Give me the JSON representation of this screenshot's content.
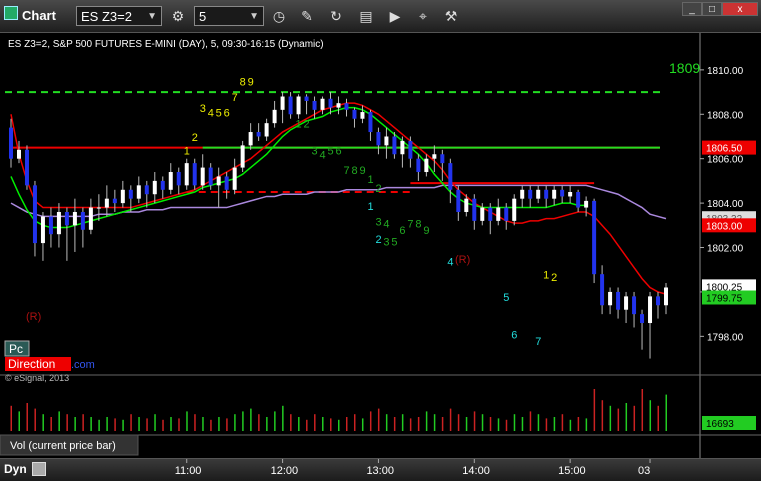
{
  "window": {
    "title": "Chart",
    "symbol_value": "ES Z3=2",
    "interval_value": "5",
    "min_label": "_",
    "max_label": "□",
    "close_label": "x"
  },
  "toolbar": {
    "tool_icons": [
      "link-icon",
      "clock-icon",
      "pencil-icon",
      "refresh-icon",
      "studies-icon",
      "play-icon",
      "tools-icon"
    ]
  },
  "chart": {
    "header": "ES Z3=2, S&P 500 FUTURES E-MINI (DAY), 5, 09:30-16:15 (Dynamic)",
    "watermark_pc": "Pc",
    "watermark_direction": "Direction",
    "watermark_com": ".com",
    "copyright": "© eSignal, 2013",
    "volume_label": "Vol (current price bar)",
    "status_label": "Dyn",
    "hline_label": "1809",
    "r_markers": [
      "(R)",
      "(R)"
    ],
    "price_tags": {
      "up": "1806.50",
      "mid": "1803.32",
      "red": "1803.00",
      "last": "1800.25",
      "green": "1799.75"
    },
    "volume_tag": "16693",
    "colors": {
      "bull": "#ffffff",
      "bear": "#2233ee",
      "wick": "#bbbbbb",
      "ema_fast": "#00ee00",
      "ema_slow": "#ee0000",
      "vwap": "#aa88dd",
      "level_red": "#ee0000",
      "level_green": "#22dd22",
      "tag_red": "#ee0000",
      "tag_green": "#22cc22",
      "count_yellow": "#eeee00",
      "count_green": "#22aa22",
      "count_cyan": "#22dddd",
      "r_color": "#aa1111"
    }
  },
  "chart_data": {
    "type": "candlestick",
    "title": "ES Z3=2, S&P 500 FUTURES E-MINI (DAY), 5, 09:30-16:15 (Dynamic)",
    "x_ticks": [
      "11:00",
      "12:00",
      "13:00",
      "14:00",
      "15:00",
      "03"
    ],
    "y_ticks": [
      "1810.00",
      "1808.00",
      "1806.00",
      "1804.00",
      "1802.00",
      "1800.00",
      "1798.00"
    ],
    "ylim": [
      1796.8,
      1811.3
    ],
    "candles": [
      [
        1807.4,
        1806.0,
        1807.8,
        1805.6
      ],
      [
        1806.0,
        1806.4,
        1806.8,
        1805.8
      ],
      [
        1806.4,
        1804.8,
        1806.6,
        1804.6
      ],
      [
        1804.8,
        1802.2,
        1805.0,
        1801.6
      ],
      [
        1802.2,
        1803.4,
        1803.6,
        1801.4
      ],
      [
        1803.4,
        1802.6,
        1803.8,
        1802.0
      ],
      [
        1802.6,
        1803.6,
        1804.0,
        1802.0
      ],
      [
        1803.6,
        1803.0,
        1803.8,
        1801.4
      ],
      [
        1803.0,
        1803.6,
        1804.2,
        1801.8
      ],
      [
        1803.6,
        1802.8,
        1803.8,
        1802.0
      ],
      [
        1802.8,
        1803.8,
        1804.2,
        1802.6
      ],
      [
        1803.8,
        1803.8,
        1804.4,
        1803.2
      ],
      [
        1803.8,
        1804.2,
        1804.8,
        1803.4
      ],
      [
        1804.2,
        1804.0,
        1804.6,
        1803.6
      ],
      [
        1804.0,
        1804.6,
        1805.0,
        1803.8
      ],
      [
        1804.6,
        1804.2,
        1804.8,
        1803.6
      ],
      [
        1804.2,
        1804.8,
        1805.2,
        1804.0
      ],
      [
        1804.8,
        1804.4,
        1805.0,
        1803.8
      ],
      [
        1804.4,
        1805.0,
        1805.4,
        1804.0
      ],
      [
        1805.0,
        1804.6,
        1805.2,
        1804.2
      ],
      [
        1804.6,
        1805.4,
        1805.8,
        1804.4
      ],
      [
        1805.4,
        1804.8,
        1805.6,
        1804.4
      ],
      [
        1804.8,
        1805.8,
        1806.0,
        1804.6
      ],
      [
        1805.8,
        1804.8,
        1806.0,
        1804.6
      ],
      [
        1804.8,
        1805.6,
        1806.2,
        1804.6
      ],
      [
        1805.6,
        1804.8,
        1805.8,
        1804.6
      ],
      [
        1804.8,
        1805.2,
        1805.6,
        1803.8
      ],
      [
        1805.2,
        1804.6,
        1805.4,
        1804.2
      ],
      [
        1804.6,
        1805.6,
        1806.0,
        1804.4
      ],
      [
        1805.6,
        1806.6,
        1806.8,
        1805.4
      ],
      [
        1806.6,
        1807.2,
        1807.6,
        1806.4
      ],
      [
        1807.2,
        1807.0,
        1807.6,
        1806.8
      ],
      [
        1807.0,
        1807.6,
        1807.8,
        1806.8
      ],
      [
        1807.6,
        1808.2,
        1808.6,
        1807.4
      ],
      [
        1808.2,
        1808.8,
        1809.0,
        1807.6
      ],
      [
        1808.8,
        1808.0,
        1809.0,
        1807.8
      ],
      [
        1808.0,
        1808.8,
        1808.9,
        1807.8
      ],
      [
        1808.8,
        1808.6,
        1808.9,
        1808.0
      ],
      [
        1808.6,
        1808.2,
        1808.8,
        1807.8
      ],
      [
        1808.2,
        1808.7,
        1808.8,
        1808.0
      ],
      [
        1808.7,
        1808.3,
        1809.0,
        1808.0
      ],
      [
        1808.3,
        1808.5,
        1808.8,
        1808.0
      ],
      [
        1808.5,
        1808.2,
        1808.7,
        1807.9
      ],
      [
        1808.2,
        1807.8,
        1808.3,
        1807.4
      ],
      [
        1807.8,
        1808.1,
        1808.4,
        1807.6
      ],
      [
        1808.1,
        1807.2,
        1808.2,
        1806.8
      ],
      [
        1807.2,
        1806.6,
        1807.4,
        1806.2
      ],
      [
        1806.6,
        1807.0,
        1807.4,
        1806.0
      ],
      [
        1807.0,
        1806.2,
        1807.2,
        1806.0
      ],
      [
        1806.2,
        1806.8,
        1807.0,
        1805.6
      ],
      [
        1806.8,
        1806.0,
        1807.0,
        1805.6
      ],
      [
        1806.0,
        1805.4,
        1806.2,
        1805.0
      ],
      [
        1805.4,
        1806.0,
        1806.2,
        1805.2
      ],
      [
        1806.0,
        1806.2,
        1806.6,
        1805.4
      ],
      [
        1806.2,
        1805.8,
        1806.4,
        1805.0
      ],
      [
        1805.8,
        1804.6,
        1806.0,
        1804.0
      ],
      [
        1804.6,
        1803.6,
        1804.8,
        1803.2
      ],
      [
        1803.6,
        1804.2,
        1804.4,
        1803.4
      ],
      [
        1804.2,
        1803.2,
        1804.4,
        1802.8
      ],
      [
        1803.2,
        1803.8,
        1804.0,
        1803.0
      ],
      [
        1803.8,
        1803.2,
        1804.0,
        1802.6
      ],
      [
        1803.2,
        1803.8,
        1804.2,
        1803.0
      ],
      [
        1803.8,
        1803.2,
        1804.0,
        1802.8
      ],
      [
        1803.2,
        1804.2,
        1804.4,
        1803.0
      ],
      [
        1804.2,
        1804.6,
        1804.8,
        1803.8
      ],
      [
        1804.6,
        1804.2,
        1804.8,
        1803.8
      ],
      [
        1804.2,
        1804.6,
        1804.8,
        1804.0
      ],
      [
        1804.6,
        1804.2,
        1804.8,
        1803.8
      ],
      [
        1804.2,
        1804.6,
        1804.8,
        1803.9
      ],
      [
        1804.6,
        1804.3,
        1804.8,
        1804.0
      ],
      [
        1804.3,
        1804.5,
        1804.8,
        1804.0
      ],
      [
        1804.5,
        1803.8,
        1804.6,
        1803.6
      ],
      [
        1803.8,
        1804.1,
        1804.3,
        1803.4
      ],
      [
        1804.1,
        1800.8,
        1804.2,
        1800.4
      ],
      [
        1800.8,
        1799.4,
        1801.2,
        1799.0
      ],
      [
        1799.4,
        1800.0,
        1800.2,
        1799.0
      ],
      [
        1800.0,
        1799.2,
        1800.2,
        1798.8
      ],
      [
        1799.2,
        1799.8,
        1800.0,
        1798.6
      ],
      [
        1799.8,
        1799.0,
        1800.0,
        1798.4
      ],
      [
        1799.0,
        1798.6,
        1799.2,
        1797.4
      ],
      [
        1798.6,
        1799.8,
        1800.0,
        1797.0
      ],
      [
        1799.8,
        1799.4,
        1800.0,
        1798.8
      ],
      [
        1799.4,
        1800.2,
        1800.4,
        1799.0
      ]
    ],
    "ema_fast": [
      1805.2,
      1804.4,
      1803.7,
      1803.2,
      1803.0,
      1802.9,
      1802.9,
      1802.9,
      1803.0,
      1803.1,
      1803.2,
      1803.3,
      1803.4,
      1803.5,
      1803.6,
      1803.7,
      1803.8,
      1803.9,
      1804.0,
      1804.1,
      1804.2,
      1804.3,
      1804.4,
      1804.5,
      1804.7,
      1804.8,
      1804.9,
      1805.0,
      1805.1,
      1805.3,
      1805.6,
      1805.9,
      1806.2,
      1806.6,
      1807.0,
      1807.3,
      1807.5,
      1807.7,
      1807.8,
      1807.9,
      1808.1,
      1808.2,
      1808.3,
      1808.3,
      1808.2,
      1808.0,
      1807.7,
      1807.4,
      1807.1,
      1806.8,
      1806.5,
      1806.2,
      1805.8,
      1805.3,
      1804.9,
      1804.5,
      1804.2,
      1804.0,
      1803.9,
      1803.8,
      1803.8,
      1803.8,
      1803.8,
      1803.8,
      1803.8,
      1803.8,
      1803.8,
      1803.8,
      1803.9,
      1804.0,
      1804.0,
      1803.9,
      1803.9,
      null,
      null,
      null,
      null,
      null,
      null,
      null,
      null,
      null,
      null
    ],
    "ema_slow": [
      1808.0,
      1806.2,
      1805.0,
      1804.1,
      1803.8,
      1803.8,
      1803.8,
      1803.8,
      1803.8,
      1803.8,
      1803.8,
      1803.8,
      1803.8,
      1803.8,
      1803.8,
      1803.8,
      1803.9,
      1804.0,
      1804.1,
      1804.2,
      1804.3,
      1804.4,
      1804.5,
      1804.6,
      1804.8,
      1805.0,
      1805.2,
      1805.4,
      1805.6,
      1805.8,
      1806.0,
      1806.3,
      1806.6,
      1806.9,
      1807.2,
      1807.4,
      1807.6,
      1807.8,
      1808.0,
      1808.2,
      1808.3,
      1808.4,
      1808.5,
      1808.5,
      1808.4,
      1808.2,
      1808.0,
      1807.7,
      1807.4,
      1807.1,
      1806.8,
      1806.5,
      1806.2,
      1805.9,
      1805.5,
      1805.0,
      1804.6,
      1804.3,
      1804.0,
      1803.8,
      1803.6,
      1803.4,
      1803.2,
      1803.1,
      1803.1,
      1803.2,
      1803.2,
      1803.3,
      1803.3,
      1803.4,
      1803.5,
      1803.6,
      1803.6,
      1803.4,
      1803.0,
      1802.6,
      1802.1,
      1801.6,
      1801.1,
      1800.6,
      1800.2,
      1800.0,
      1799.9
    ],
    "vwap": [
      1804.0,
      1803.8,
      1803.6,
      1803.5,
      1803.4,
      1803.4,
      1803.4,
      1803.4,
      1803.4,
      1803.4,
      1803.4,
      1803.5,
      1803.5,
      1803.5,
      1803.6,
      1803.6,
      1803.6,
      1803.7,
      1803.7,
      1803.7,
      1803.8,
      1803.8,
      1803.8,
      1803.8,
      1803.8,
      1803.8,
      1803.8,
      1803.8,
      1803.9,
      1804.0,
      1804.1,
      1804.2,
      1804.3,
      1804.3,
      1804.4,
      1804.4,
      1804.4,
      1804.4,
      1804.5,
      1804.5,
      1804.5,
      1804.5,
      1804.6,
      1804.6,
      1804.6,
      1804.6,
      1804.6,
      1804.7,
      1804.7,
      1804.7,
      1804.7,
      1804.7,
      1804.7,
      1804.7,
      1804.8,
      1804.8,
      1804.8,
      1804.8,
      1804.8,
      1804.8,
      1804.8,
      1804.8,
      1804.8,
      1804.8,
      1804.8,
      1804.8,
      1804.8,
      1804.8,
      1804.8,
      1804.8,
      1804.8,
      1804.8,
      1804.8,
      1804.7,
      1804.6,
      1804.5,
      1804.4,
      1804.2,
      1804.0,
      1803.8,
      1803.5,
      1803.4,
      1803.3
    ],
    "levels": [
      {
        "value": 1809.0,
        "color": "green",
        "style": "dashed"
      },
      {
        "value": 1806.5,
        "color": "red",
        "style": "solid",
        "from_index": 0
      },
      {
        "value": 1806.5,
        "color": "green",
        "style": "solid",
        "from_index": 24
      },
      {
        "value": 1804.5,
        "color": "red",
        "style": "dashed",
        "from_index": 22,
        "to_index": 50
      },
      {
        "value": 1804.9,
        "color": "red",
        "style": "solid",
        "from_index": 50,
        "to_index": 73
      }
    ],
    "counts": [
      {
        "text": "1",
        "i": 22,
        "v": 1806.2,
        "c": "yellow"
      },
      {
        "text": "2",
        "i": 23,
        "v": 1806.8,
        "c": "yellow"
      },
      {
        "text": "3",
        "i": 24,
        "v": 1808.1,
        "c": "yellow"
      },
      {
        "text": "4",
        "i": 25,
        "v": 1807.9,
        "c": "yellow"
      },
      {
        "text": "5",
        "i": 26,
        "v": 1807.9,
        "c": "yellow"
      },
      {
        "text": "6",
        "i": 27,
        "v": 1807.9,
        "c": "yellow"
      },
      {
        "text": "7",
        "i": 28,
        "v": 1808.6,
        "c": "yellow"
      },
      {
        "text": "8",
        "i": 29,
        "v": 1809.3,
        "c": "yellow"
      },
      {
        "text": "9",
        "i": 30,
        "v": 1809.3,
        "c": "yellow"
      },
      {
        "text": "1",
        "i": 36,
        "v": 1807.4,
        "c": "green"
      },
      {
        "text": "2",
        "i": 37,
        "v": 1807.4,
        "c": "green"
      },
      {
        "text": "3",
        "i": 38,
        "v": 1806.2,
        "c": "green"
      },
      {
        "text": "4",
        "i": 39,
        "v": 1806.0,
        "c": "green"
      },
      {
        "text": "5",
        "i": 40,
        "v": 1806.2,
        "c": "green"
      },
      {
        "text": "6",
        "i": 41,
        "v": 1806.2,
        "c": "green"
      },
      {
        "text": "7",
        "i": 42,
        "v": 1805.3,
        "c": "green"
      },
      {
        "text": "8",
        "i": 43,
        "v": 1805.3,
        "c": "green"
      },
      {
        "text": "9",
        "i": 44,
        "v": 1805.3,
        "c": "green"
      },
      {
        "text": "1",
        "i": 45,
        "v": 1804.9,
        "c": "green"
      },
      {
        "text": "2",
        "i": 46,
        "v": 1804.5,
        "c": "green"
      },
      {
        "text": "1",
        "i": 45,
        "v": 1803.7,
        "c": "cyan"
      },
      {
        "text": "3",
        "i": 46,
        "v": 1803.0,
        "c": "green"
      },
      {
        "text": "4",
        "i": 47,
        "v": 1802.9,
        "c": "green"
      },
      {
        "text": "2",
        "i": 46,
        "v": 1802.2,
        "c": "cyan"
      },
      {
        "text": "3",
        "i": 47,
        "v": 1802.1,
        "c": "green"
      },
      {
        "text": "5",
        "i": 48,
        "v": 1802.1,
        "c": "green"
      },
      {
        "text": "6",
        "i": 49,
        "v": 1802.6,
        "c": "green"
      },
      {
        "text": "7",
        "i": 50,
        "v": 1802.9,
        "c": "green"
      },
      {
        "text": "8",
        "i": 51,
        "v": 1802.9,
        "c": "green"
      },
      {
        "text": "9",
        "i": 52,
        "v": 1802.6,
        "c": "green"
      },
      {
        "text": "4",
        "i": 55,
        "v": 1801.2,
        "c": "cyan"
      },
      {
        "text": "5",
        "i": 62,
        "v": 1799.6,
        "c": "cyan"
      },
      {
        "text": "6",
        "i": 63,
        "v": 1797.9,
        "c": "cyan"
      },
      {
        "text": "7",
        "i": 66,
        "v": 1797.6,
        "c": "cyan"
      },
      {
        "text": "1",
        "i": 67,
        "v": 1800.6,
        "c": "yellow"
      },
      {
        "text": "2",
        "i": 68,
        "v": 1800.5,
        "c": "yellow"
      }
    ],
    "volume": [
      18,
      14,
      20,
      16,
      12,
      10,
      14,
      12,
      10,
      12,
      10,
      8,
      10,
      9,
      8,
      12,
      10,
      9,
      12,
      8,
      10,
      9,
      14,
      12,
      10,
      8,
      10,
      9,
      12,
      14,
      16,
      12,
      10,
      14,
      18,
      12,
      10,
      8,
      12,
      10,
      9,
      8,
      10,
      12,
      9,
      14,
      16,
      12,
      10,
      12,
      9,
      10,
      14,
      12,
      10,
      16,
      12,
      10,
      14,
      12,
      10,
      9,
      8,
      12,
      10,
      14,
      12,
      9,
      10,
      12,
      8,
      10,
      9,
      30,
      22,
      18,
      16,
      20,
      18,
      30,
      22,
      18,
      26
    ]
  }
}
